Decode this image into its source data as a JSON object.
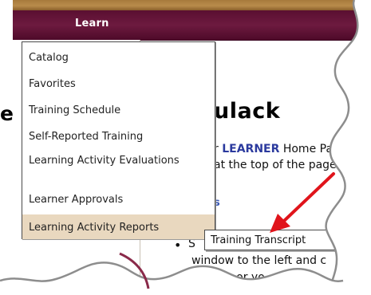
{
  "nav": {
    "menu_title": "Learn"
  },
  "menu": {
    "items": [
      {
        "label": "Catalog"
      },
      {
        "label": "Favorites"
      },
      {
        "label": "Training Schedule"
      },
      {
        "label": "Self-Reported Training"
      },
      {
        "label": "Learning Activity Evaluations"
      },
      {
        "label": "Learner Approvals"
      },
      {
        "label": "Learning Activity Reports",
        "highlighted": true
      }
    ]
  },
  "submenu": {
    "item_label": "Training Transcript"
  },
  "page": {
    "heading_left": "e",
    "heading_right": "ulack",
    "text_line1_prefix": "r ",
    "text_line1_highlight": "LEARNER",
    "text_line1_suffix": " Home Pa",
    "text_line2": "at the top of the page.",
    "text_line3": "s",
    "bullet_line1": "S",
    "text_line4": "window to the left and c",
    "text_line5": "catalog or yo"
  },
  "colors": {
    "nav_bar": "#5a0f31",
    "top_strip": "#a77a3c",
    "menu_highlight": "#e9d8bf",
    "arrow": "#e0141b",
    "learner_text": "#2b3a9e"
  },
  "icons": {
    "arrow": "red-callout-arrow"
  }
}
